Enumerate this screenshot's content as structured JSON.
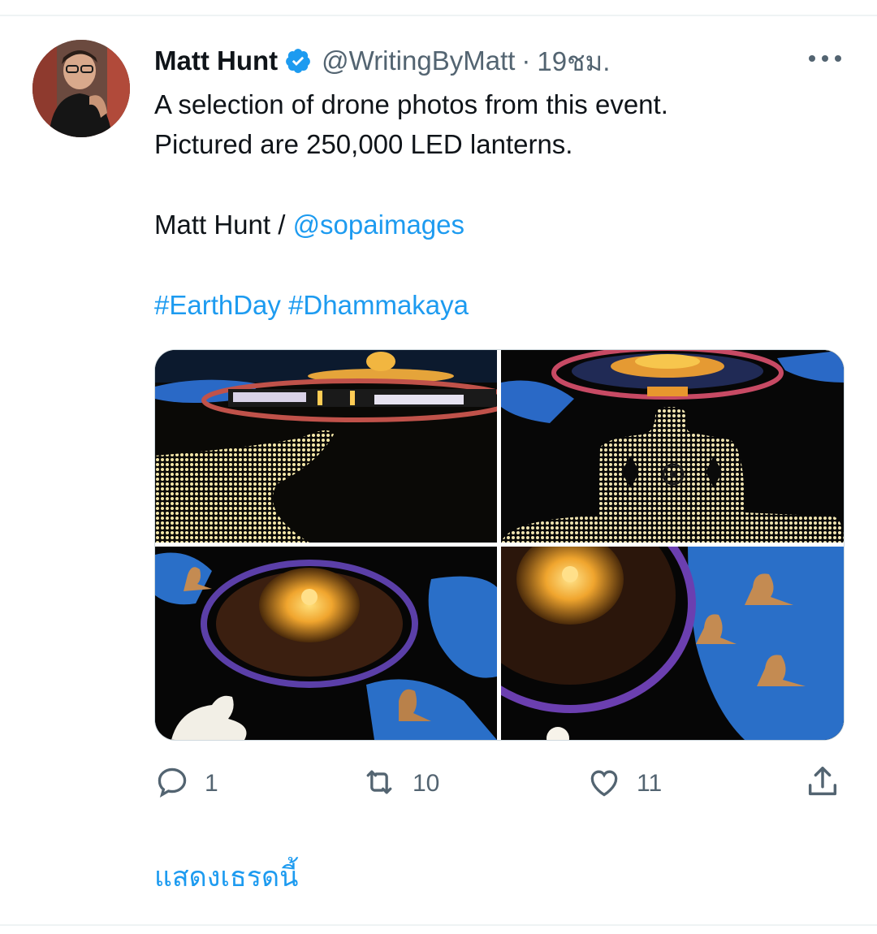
{
  "tweet": {
    "author_name": "Matt Hunt",
    "author_handle": "@WritingByMatt",
    "separator": "·",
    "timestamp": "19ชม.",
    "text_line1": "A selection of drone photos from this event.",
    "text_line2": "Pictured are 250,000 LED lanterns.",
    "credit_prefix": "Matt Hunt / ",
    "credit_mention": "@sopaimages",
    "hashtags": "#EarthDay #Dhammakaya"
  },
  "actions": {
    "replies": "1",
    "retweets": "10",
    "likes": "11"
  },
  "show_thread_label": "แสดงเธรดนี้",
  "icons": {
    "verified": "verified-badge-icon",
    "more": "more-options-icon",
    "reply": "reply-icon",
    "retweet": "retweet-icon",
    "like": "like-icon",
    "share": "share-icon"
  },
  "colors": {
    "link": "#1d9bf0",
    "secondary_text": "#536471",
    "primary_text": "#0f1419"
  }
}
